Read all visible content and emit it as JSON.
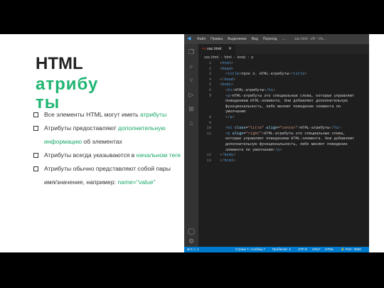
{
  "slide": {
    "title_line1": "HTML",
    "title_line2": "атрибуты",
    "bullets": [
      {
        "before": "Все элементы HTML могут иметь ",
        "highlight": "атрибуты",
        "after": ""
      },
      {
        "before": "Атрибуты предоставляют ",
        "highlight": "дополнительную информацию",
        "after": " об элементах"
      },
      {
        "before": "Атрибуты всегда указываются в ",
        "highlight": "начальном теге",
        "after": ""
      },
      {
        "before": "Атрибуты обычно представляют собой пары имя/значение, например: ",
        "highlight": "name=\"value\"",
        "after": ""
      }
    ],
    "accent_color": "#21b573"
  },
  "editor": {
    "menu": [
      "Файл",
      "Правка",
      "Выделение",
      "Вид",
      "Переход",
      "..."
    ],
    "window_title": "zac.html - zR - Vis...",
    "tab": {
      "label": "zac.html",
      "modified": "1",
      "close": "✕"
    },
    "breadcrumb": [
      "zac.html",
      "html",
      "body",
      "p"
    ],
    "lines": [
      {
        "n": "1",
        "text": "<html>"
      },
      {
        "n": "2",
        "text": "<head>"
      },
      {
        "n": "3",
        "text": "<title>Урок 3. HTML-атрибуты</title>"
      },
      {
        "n": "4",
        "text": "</head>"
      },
      {
        "n": "5",
        "text": "<body>"
      },
      {
        "n": "6",
        "text": "<h1>HTML-атрибуты</h1>"
      },
      {
        "n": "7",
        "text": "<p>HTML-атрибуты это специальные слова, которые управляют"
      },
      {
        "n": "",
        "text": "поведением HTML-элемента. Они добавляют дополнительную"
      },
      {
        "n": "",
        "text": "функциональность, либо меняют поведение элемента по"
      },
      {
        "n": "",
        "text": "умолчанию"
      },
      {
        "n": "8",
        "text": "</p>"
      },
      {
        "n": "9",
        "text": ""
      },
      {
        "n": "10",
        "text": "<h1 class=\"title\" align=\"center\">HTML-атрибуты</h1>"
      },
      {
        "n": "11",
        "text": "<p align=\"right\">HTML-атрибуты это специальные слова,"
      },
      {
        "n": "",
        "text": "которые управляют поведением HTML-элемента. Они добавляют"
      },
      {
        "n": "",
        "text": "дополнительную функциональность, либо меняют поведение"
      },
      {
        "n": "",
        "text": "элемента по умолчанию</p>"
      },
      {
        "n": "12",
        "text": "</body>"
      },
      {
        "n": "13",
        "text": "</html>"
      }
    ],
    "status": {
      "problems": "⊗ 0 ⚠ 1",
      "cursor": "Строка 7, столбец 7",
      "spaces": "Пробелов: 4",
      "encoding": "UTF-8",
      "eol": "CRLF",
      "language": "HTML",
      "port": "⚡ Port : 5500"
    }
  }
}
